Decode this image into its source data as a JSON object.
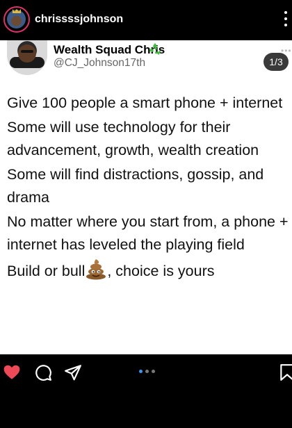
{
  "header": {
    "username": "chrissssjohnson"
  },
  "post": {
    "display_name": "Wealth Squad Chris",
    "handle": "@CJ_Johnson17th",
    "slide_counter": "1/3",
    "corner_dots": "•••",
    "paragraphs": [
      "Give 100 people a smart phone + internet",
      "Some will use technology for their advancement, growth, wealth creation",
      "Some will find distractions, gossip, and drama",
      "No matter where you start from, a phone + internet has leveled the playing field"
    ],
    "last_line_before": "Build or bull",
    "last_line_after": ", choice is yours"
  },
  "carousel": {
    "total_dots": 3,
    "active_index": 0
  },
  "colors": {
    "like_red": "#ed4956",
    "story_ring": "#e1306c",
    "pager_active": "#3897f0",
    "recycle_green": "#3dbb3d"
  },
  "icons": [
    "more-options-icon",
    "recycle-icon",
    "poop-emoji-icon",
    "heart-icon",
    "comment-icon",
    "share-icon",
    "bookmark-icon"
  ]
}
